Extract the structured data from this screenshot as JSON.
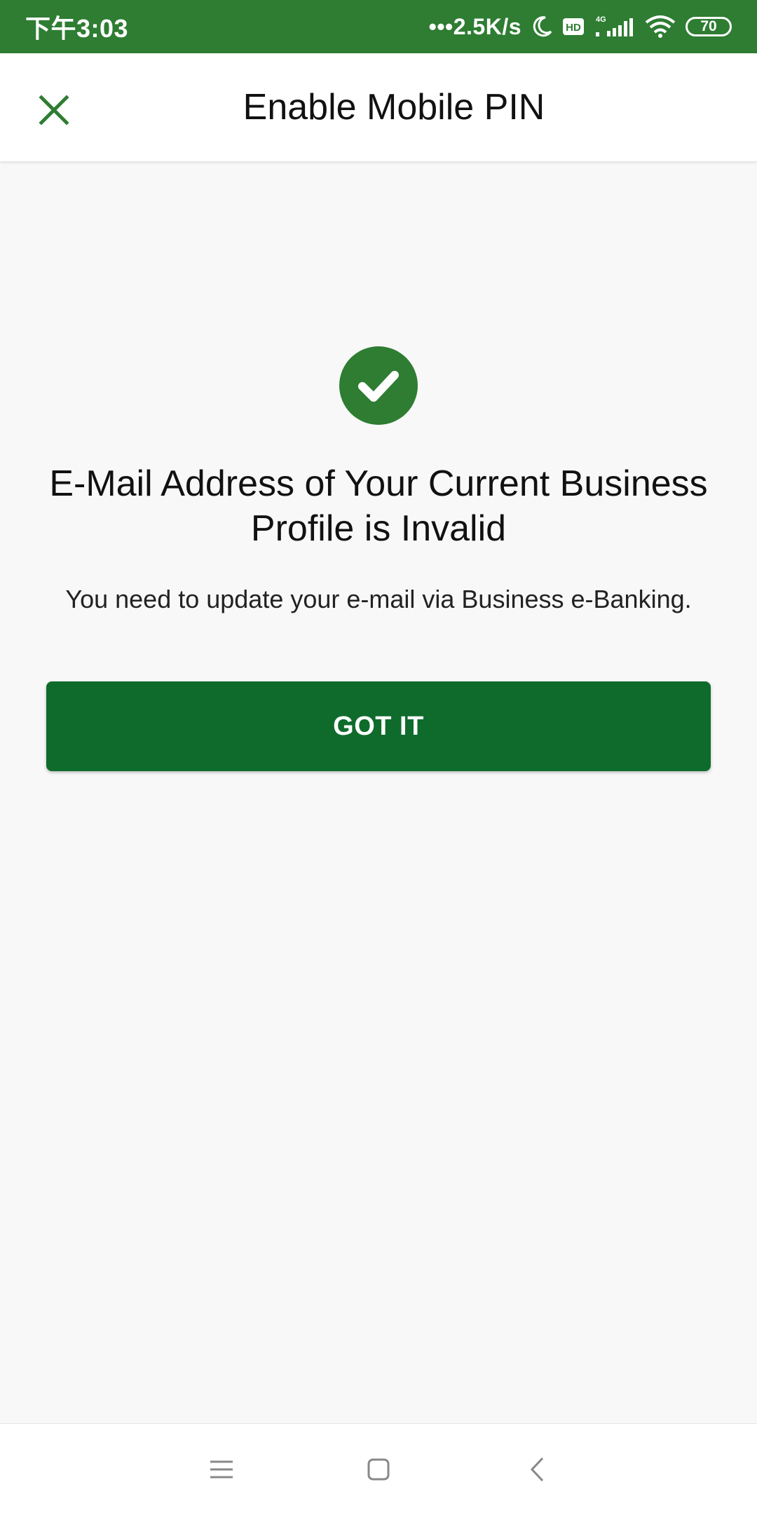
{
  "status_bar": {
    "time": "下午3:03",
    "network_speed": "•••2.5K/s",
    "battery": "70",
    "icons": [
      "moon-icon",
      "hd-icon",
      "signal-4g-icon",
      "wifi-icon",
      "battery-icon"
    ]
  },
  "app_bar": {
    "title": "Enable Mobile PIN",
    "close_icon": "close-icon"
  },
  "main": {
    "status_icon": "check-circle-icon",
    "heading": "E-Mail Address of Your Current Business Profile is Invalid",
    "message": "You need to update your e-mail via Business e-Banking.",
    "button_label": "GOT IT"
  },
  "nav_bar": {
    "icons": [
      "menu-icon",
      "home-icon",
      "back-icon"
    ]
  },
  "colors": {
    "primary": "#2e7d32",
    "button": "#0f6b2c",
    "background": "#f8f8f8"
  }
}
